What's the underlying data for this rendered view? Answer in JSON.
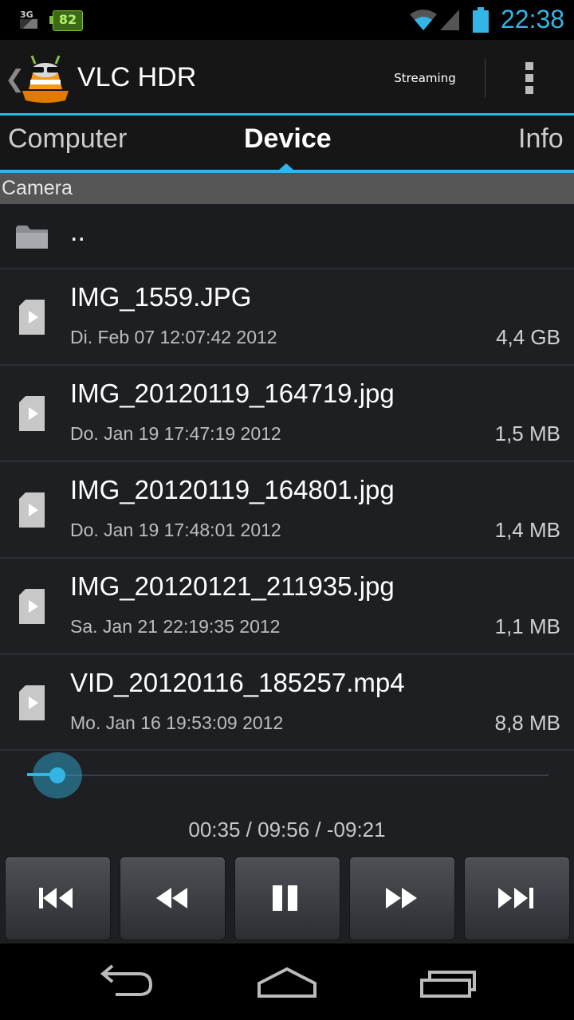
{
  "status_bar": {
    "network_label": "3G",
    "battery_level": "82",
    "time": "22:38",
    "accent_color": "#33b5e5"
  },
  "action_bar": {
    "title": "VLC HDR",
    "streaming_label": "Streaming",
    "icons": [
      "up-caret-icon",
      "vlc-cone-logo",
      "overflow-menu-icon"
    ]
  },
  "tabs": [
    {
      "label": "Computer",
      "selected": false
    },
    {
      "label": "Device",
      "selected": true
    },
    {
      "label": "Info",
      "selected": false
    }
  ],
  "section": {
    "title": "Camera"
  },
  "list": {
    "parent_label": "..",
    "files": [
      {
        "name": "IMG_1559.JPG",
        "date": "Di. Feb 07 12:07:42 2012",
        "size": "4,4 GB"
      },
      {
        "name": "IMG_20120119_164719.jpg",
        "date": "Do. Jan 19 17:47:19 2012",
        "size": "1,5 MB"
      },
      {
        "name": "IMG_20120119_164801.jpg",
        "date": "Do. Jan 19 17:48:01 2012",
        "size": "1,4 MB"
      },
      {
        "name": "IMG_20120121_211935.jpg",
        "date": "Sa. Jan 21 22:19:35 2012",
        "size": "1,1 MB"
      },
      {
        "name": "VID_20120116_185257.mp4",
        "date": "Mo. Jan 16 19:53:09 2012",
        "size": "8,8 MB"
      }
    ]
  },
  "player": {
    "time_display": "00:35 / 09:56 / -09:21",
    "elapsed_seconds": 35,
    "duration_seconds": 596,
    "controls": [
      "previous",
      "rewind",
      "pause",
      "fast-forward",
      "next"
    ]
  },
  "nav_bar": {
    "buttons": [
      "back",
      "home",
      "recent-apps"
    ]
  }
}
